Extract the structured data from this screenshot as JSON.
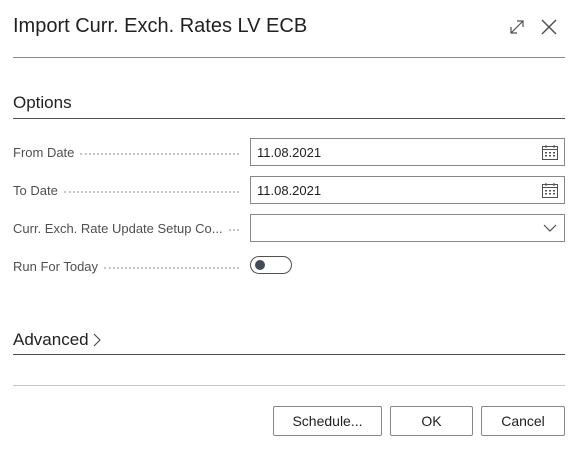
{
  "dialog": {
    "title": "Import Curr. Exch. Rates LV ECB",
    "expand_icon": "expand-icon",
    "close_icon": "close-icon"
  },
  "options": {
    "section_title": "Options",
    "fields": [
      {
        "label": "From Date",
        "value": "11.08.2021",
        "icon": "calendar-icon"
      },
      {
        "label": "To Date",
        "value": "11.08.2021",
        "icon": "calendar-icon"
      },
      {
        "label": "Curr. Exch. Rate Update Setup Co...",
        "value": "",
        "icon": "chevron-down-icon"
      }
    ],
    "toggle": {
      "label": "Run For Today",
      "on": false
    }
  },
  "advanced": {
    "section_title": "Advanced",
    "icon": "chevron-right-icon"
  },
  "buttons": {
    "schedule": "Schedule...",
    "ok": "OK",
    "cancel": "Cancel"
  },
  "colors": {
    "accent": "#414b58",
    "border": "#8a8886",
    "label": "#505050"
  }
}
